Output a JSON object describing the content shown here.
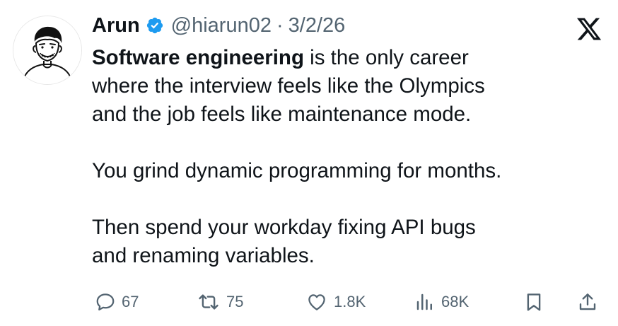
{
  "author": {
    "name": "Arun",
    "handle": "@hiarun02",
    "separator": "·",
    "date": "3/2/26",
    "verified": true,
    "verified_color": "#1d9bf0"
  },
  "platform_icon": "x-logo-icon",
  "body": {
    "line1_bold": "Software engineering",
    "line1_rest": " is the only career",
    "line2": "where the interview feels like the Olympics",
    "line3": "and the job feels like maintenance mode.",
    "line4": "You grind dynamic programming for months.",
    "line5": "Then spend your workday fixing API bugs",
    "line6": "and renaming variables."
  },
  "actions": {
    "replies": "67",
    "reposts": "75",
    "likes": "1.8K",
    "views": "68K",
    "icons": [
      "reply-icon",
      "repost-icon",
      "like-icon",
      "views-icon",
      "bookmark-icon",
      "share-icon"
    ],
    "icon_color": "#536471"
  },
  "colors": {
    "text": "#0f1419",
    "secondary": "#536471",
    "background": "#ffffff"
  }
}
